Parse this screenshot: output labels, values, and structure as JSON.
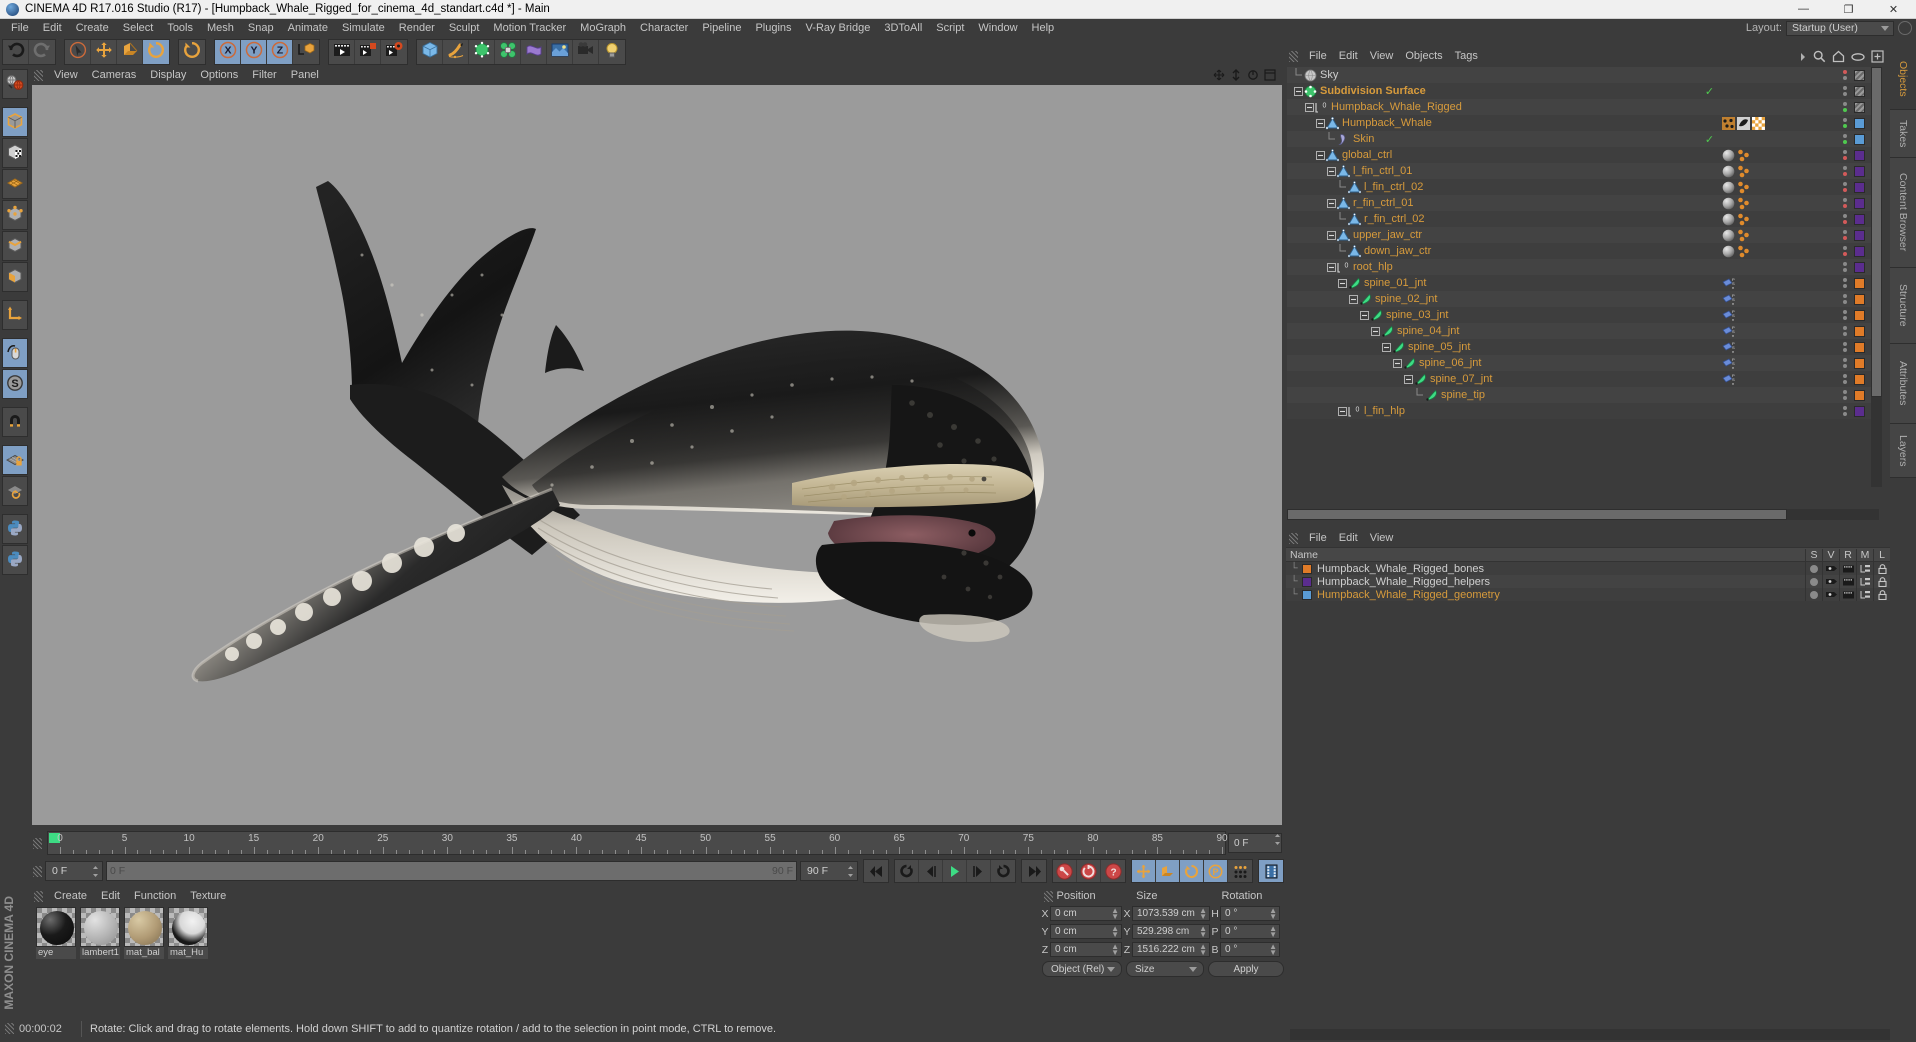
{
  "window": {
    "title": "CINEMA 4D R17.016 Studio (R17) - [Humpback_Whale_Rigged_for_cinema_4d_standart.c4d *] - Main",
    "minimize": "—",
    "maximize": "❐",
    "close": "✕"
  },
  "menubar": {
    "items": [
      "File",
      "Edit",
      "Create",
      "Select",
      "Tools",
      "Mesh",
      "Snap",
      "Animate",
      "Simulate",
      "Render",
      "Sculpt",
      "Motion Tracker",
      "MoGraph",
      "Character",
      "Pipeline",
      "Plugins",
      "V-Ray Bridge",
      "3DToAll",
      "Script",
      "Window",
      "Help"
    ],
    "layout_label": "Layout:",
    "layout_value": "Startup (User)"
  },
  "toolbar": {
    "groups": [
      {
        "name": "undo-redo",
        "buttons": [
          {
            "name": "undo-button",
            "icon": "undo-icon",
            "active": false
          },
          {
            "name": "redo-button",
            "icon": "redo-icon",
            "active": false
          }
        ]
      },
      {
        "name": "transform-tools",
        "buttons": [
          {
            "name": "select-tool",
            "icon": "select-cursor-icon",
            "active": false
          },
          {
            "name": "move-tool",
            "icon": "move-arrows-icon",
            "active": false
          },
          {
            "name": "scale-tool",
            "icon": "scale-box-icon",
            "active": false
          },
          {
            "name": "rotate-tool",
            "icon": "rotate-circle-icon",
            "active": true
          }
        ]
      },
      {
        "name": "rotate-group",
        "buttons": [
          {
            "name": "rotate-tool-2",
            "icon": "rotate-circle-icon",
            "active": false
          }
        ]
      },
      {
        "name": "axis-locks",
        "buttons": [
          {
            "name": "x-axis-lock",
            "icon": "x-axis-icon",
            "active": true
          },
          {
            "name": "y-axis-lock",
            "icon": "y-axis-icon",
            "active": true
          },
          {
            "name": "z-axis-lock",
            "icon": "z-axis-icon",
            "active": true
          },
          {
            "name": "world-object-axis",
            "icon": "world-axis-icon",
            "active": false
          }
        ]
      },
      {
        "name": "render-group",
        "buttons": [
          {
            "name": "render-view-button",
            "icon": "render-view-icon",
            "active": false
          },
          {
            "name": "render-to-picture-viewer-button",
            "icon": "render-picture-icon",
            "active": false
          },
          {
            "name": "render-settings-button",
            "icon": "render-settings-icon",
            "active": false
          }
        ]
      },
      {
        "name": "object-group",
        "buttons": [
          {
            "name": "add-cube-button",
            "icon": "cube-icon",
            "active": false
          },
          {
            "name": "add-spline-button",
            "icon": "pen-spline-icon",
            "active": false
          },
          {
            "name": "nurbs-button",
            "icon": "green-cube-icon",
            "active": false
          },
          {
            "name": "array-button",
            "icon": "green-cluster-icon",
            "active": false
          },
          {
            "name": "deformer-button",
            "icon": "deformer-icon",
            "active": false
          },
          {
            "name": "environment-button",
            "icon": "environment-icon",
            "active": false
          },
          {
            "name": "camera-button",
            "icon": "camera-icon",
            "active": false
          },
          {
            "name": "light-button",
            "icon": "light-bulb-icon",
            "active": false
          }
        ]
      }
    ]
  },
  "leftbar": {
    "buttons": [
      {
        "name": "make-editable-button",
        "icon": "world-globe-icon",
        "active": false
      },
      {
        "name": "model-mode-button",
        "icon": "model-cube-icon",
        "active": true
      },
      {
        "name": "texture-mode-button",
        "icon": "texture-cube-icon",
        "active": false
      },
      {
        "name": "polygon-mode-button",
        "icon": "polygon-grid-icon",
        "active": false
      },
      {
        "name": "point-mode-button",
        "icon": "point-cube-icon",
        "active": false
      },
      {
        "name": "edge-mode-button",
        "icon": "edge-cube-icon",
        "active": false
      },
      {
        "name": "face-mode-button",
        "icon": "face-cube-icon",
        "active": false
      },
      {
        "name": "axis-mode-button",
        "icon": "axis-l-icon",
        "active": false
      },
      {
        "name": "viewport-solo-button",
        "icon": "mouse-icon",
        "active": true
      },
      {
        "name": "soft-selection-button",
        "icon": "s-circle-icon",
        "active": true
      },
      {
        "name": "magnet-button",
        "icon": "magnet-icon",
        "active": false
      },
      {
        "name": "lock-workplane-button",
        "icon": "workplane-lock-icon",
        "active": true
      },
      {
        "name": "planar-workplane-button",
        "icon": "workplane-rotate-icon",
        "active": false
      },
      {
        "name": "python-button-1",
        "icon": "python-icon",
        "active": false
      },
      {
        "name": "python-button-2",
        "icon": "python-icon",
        "active": false
      }
    ],
    "brand": "MAXON CINEMA 4D"
  },
  "viewport": {
    "menu": [
      "View",
      "Cameras",
      "Display",
      "Options",
      "Filter",
      "Panel"
    ],
    "nav_icons": [
      "pan-icon",
      "zoom-icon",
      "rotate-icon",
      "maximize-icon"
    ],
    "background_color": "#9b9b9b",
    "subject": "humpback whale 3d model"
  },
  "timeline": {
    "start_label": "0",
    "ticks": [
      "0",
      "5",
      "10",
      "15",
      "20",
      "25",
      "30",
      "35",
      "40",
      "45",
      "50",
      "55",
      "60",
      "65",
      "70",
      "75",
      "80",
      "85",
      "90"
    ],
    "current_frame_field": "0 F",
    "left_frame_field": "0 F",
    "range_start": "0 F",
    "range_end": "90 F",
    "end_frame_field": "90 F",
    "transport_buttons": [
      {
        "name": "go-to-start-button",
        "icon": "skip-start-icon"
      },
      {
        "name": "play-backwards-button",
        "icon": "rewind-loop-icon"
      },
      {
        "name": "previous-frame-button",
        "icon": "step-back-icon"
      },
      {
        "name": "play-forward-button",
        "icon": "play-icon"
      },
      {
        "name": "next-frame-button",
        "icon": "step-forward-icon"
      },
      {
        "name": "play-loop-button",
        "icon": "loop-icon"
      },
      {
        "name": "go-to-end-button",
        "icon": "skip-end-icon"
      }
    ],
    "key_buttons": [
      {
        "name": "record-keyframe-button",
        "icon": "key-record-icon"
      },
      {
        "name": "autokeying-button",
        "icon": "autokey-icon"
      },
      {
        "name": "keyframe-selection-button",
        "icon": "key-question-icon"
      }
    ],
    "pos_buttons": [
      {
        "name": "record-position-button",
        "icon": "move-arrows-icon",
        "active": true
      },
      {
        "name": "record-scale-button",
        "icon": "scale-box-icon",
        "active": true
      },
      {
        "name": "record-rotation-button",
        "icon": "rotate-circle-icon",
        "active": true
      },
      {
        "name": "record-param-button",
        "icon": "p-circle-icon",
        "active": true
      },
      {
        "name": "record-pla-button",
        "icon": "dots-grid-icon",
        "active": false
      },
      {
        "name": "timeline-toggle-button",
        "icon": "film-strip-icon",
        "active": true
      }
    ]
  },
  "materials": {
    "menu": [
      "Create",
      "Edit",
      "Function",
      "Texture"
    ],
    "items": [
      {
        "name": "eye",
        "color": "#1a1a1a",
        "label": "eye"
      },
      {
        "name": "lambert1",
        "color": "#b4b4b4",
        "label": "lambert1"
      },
      {
        "name": "mat_ball",
        "color": "#b09a74",
        "label": "mat_bal"
      },
      {
        "name": "mat_Humpback",
        "color": "#e8e8e8",
        "label": "mat_Hu"
      }
    ]
  },
  "coordinates": {
    "headers": [
      "Position",
      "Size",
      "Rotation"
    ],
    "rows": [
      {
        "pos_axis": "X",
        "pos_value": "0 cm",
        "size_axis": "X",
        "size_value": "1073.539 cm",
        "rot_axis": "H",
        "rot_value": "0 °"
      },
      {
        "pos_axis": "Y",
        "pos_value": "0 cm",
        "size_axis": "Y",
        "size_value": "529.298 cm",
        "rot_axis": "P",
        "rot_value": "0 °"
      },
      {
        "pos_axis": "Z",
        "pos_value": "0 cm",
        "size_axis": "Z",
        "size_value": "1516.222 cm",
        "rot_axis": "B",
        "rot_value": "0 °"
      }
    ],
    "mode_dropdown": "Object (Rel)",
    "size_dropdown": "Size",
    "apply_button": "Apply"
  },
  "object_manager": {
    "menu": [
      "File",
      "Edit",
      "View",
      "Objects",
      "Tags"
    ],
    "right_icons": [
      "more-arrow-icon",
      "search-icon",
      "home-icon",
      "ellipse-icon",
      "add-icon"
    ],
    "tree": [
      {
        "label": "Sky",
        "indent": 0,
        "icon": "sky-sphere-icon",
        "color": "#cfcfcf",
        "expander": "none",
        "swatch": "hatch",
        "dots": [
          "#d35a5a",
          "#8a8a8a"
        ],
        "tags": [],
        "check": false
      },
      {
        "label": "Subdivision Surface",
        "indent": 0,
        "icon": "subdiv-icon",
        "color": "#d79b3c",
        "expander": "minus",
        "swatch": "hatch",
        "dots": [
          "#8a8a8a",
          "#8a8a8a"
        ],
        "tags": [],
        "check": true
      },
      {
        "label": "Humpback_Whale_Rigged",
        "indent": 1,
        "icon": "layer0-icon",
        "color": "#d79b3c",
        "expander": "minus",
        "swatch": "hatch",
        "dots": [
          "#8a8a8a",
          "#4fc94f"
        ],
        "tags": [],
        "check": false
      },
      {
        "label": "Humpback_Whale",
        "indent": 2,
        "icon": "polygon-obj-icon",
        "color": "#d79b3c",
        "expander": "minus",
        "swatch": "#5a9bd5",
        "dots": [
          "#8a8a8a",
          "#4fc94f"
        ],
        "tags": [
          "texture-tag",
          "phong-tag",
          "checker-tag"
        ],
        "check": false
      },
      {
        "label": "Skin",
        "indent": 3,
        "icon": "skin-icon",
        "color": "#d79b3c",
        "expander": "end",
        "swatch": "#5a9bd5",
        "dots": [
          "#8a8a8a",
          "#4fc94f"
        ],
        "tags": [],
        "check": true
      },
      {
        "label": "global_ctrl",
        "indent": 2,
        "icon": "null-obj-icon",
        "color": "#d79b3c",
        "expander": "minus",
        "swatch": "#5b2d8e",
        "dots": [
          "#8a8a8a",
          "#d35a5a"
        ],
        "tags": [
          "sphere-tag",
          "xpresso-tag"
        ],
        "check": false
      },
      {
        "label": "l_fin_ctrl_01",
        "indent": 3,
        "icon": "null-obj-icon",
        "color": "#d79b3c",
        "expander": "minus",
        "swatch": "#5b2d8e",
        "dots": [
          "#8a8a8a",
          "#d35a5a"
        ],
        "tags": [
          "sphere-tag",
          "xpresso-tag"
        ],
        "check": false
      },
      {
        "label": "l_fin_ctrl_02",
        "indent": 4,
        "icon": "null-obj-icon",
        "color": "#d79b3c",
        "expander": "end",
        "swatch": "#5b2d8e",
        "dots": [
          "#8a8a8a",
          "#d35a5a"
        ],
        "tags": [
          "sphere-tag",
          "xpresso-tag"
        ],
        "check": false
      },
      {
        "label": "r_fin_ctrl_01",
        "indent": 3,
        "icon": "null-obj-icon",
        "color": "#d79b3c",
        "expander": "minus",
        "swatch": "#5b2d8e",
        "dots": [
          "#8a8a8a",
          "#d35a5a"
        ],
        "tags": [
          "sphere-tag",
          "xpresso-tag"
        ],
        "check": false
      },
      {
        "label": "r_fin_ctrl_02",
        "indent": 4,
        "icon": "null-obj-icon",
        "color": "#d79b3c",
        "expander": "end",
        "swatch": "#5b2d8e",
        "dots": [
          "#8a8a8a",
          "#d35a5a"
        ],
        "tags": [
          "sphere-tag",
          "xpresso-tag"
        ],
        "check": false
      },
      {
        "label": "upper_jaw_ctr",
        "indent": 3,
        "icon": "null-obj-icon",
        "color": "#d79b3c",
        "expander": "minus",
        "swatch": "#5b2d8e",
        "dots": [
          "#8a8a8a",
          "#d35a5a"
        ],
        "tags": [
          "sphere-tag",
          "xpresso-tag"
        ],
        "check": false
      },
      {
        "label": "down_jaw_ctr",
        "indent": 4,
        "icon": "null-obj-icon",
        "color": "#d79b3c",
        "expander": "end",
        "swatch": "#5b2d8e",
        "dots": [
          "#8a8a8a",
          "#d35a5a"
        ],
        "tags": [
          "sphere-tag",
          "xpresso-tag"
        ],
        "check": false
      },
      {
        "label": "root_hlp",
        "indent": 3,
        "icon": "layer0-icon",
        "color": "#d79b3c",
        "expander": "minus",
        "swatch": "#5b2d8e",
        "dots": [
          "#8a8a8a",
          "#8a8a8a"
        ],
        "tags": [],
        "check": false
      },
      {
        "label": "spine_01_jnt",
        "indent": 4,
        "icon": "joint-icon",
        "color": "#d79b3c",
        "expander": "minus",
        "swatch": "#e07b28",
        "dots": [
          "#8a8a8a",
          "#8a8a8a"
        ],
        "tags": [
          "weight-tag"
        ],
        "check": false
      },
      {
        "label": "spine_02_jnt",
        "indent": 5,
        "icon": "joint-icon",
        "color": "#d79b3c",
        "expander": "minus",
        "swatch": "#e07b28",
        "dots": [
          "#8a8a8a",
          "#8a8a8a"
        ],
        "tags": [
          "weight-tag"
        ],
        "check": false
      },
      {
        "label": "spine_03_jnt",
        "indent": 6,
        "icon": "joint-icon",
        "color": "#d79b3c",
        "expander": "minus",
        "swatch": "#e07b28",
        "dots": [
          "#8a8a8a",
          "#8a8a8a"
        ],
        "tags": [
          "weight-tag"
        ],
        "check": false
      },
      {
        "label": "spine_04_jnt",
        "indent": 7,
        "icon": "joint-icon",
        "color": "#d79b3c",
        "expander": "minus",
        "swatch": "#e07b28",
        "dots": [
          "#8a8a8a",
          "#8a8a8a"
        ],
        "tags": [
          "weight-tag"
        ],
        "check": false
      },
      {
        "label": "spine_05_jnt",
        "indent": 8,
        "icon": "joint-icon",
        "color": "#d79b3c",
        "expander": "minus",
        "swatch": "#e07b28",
        "dots": [
          "#8a8a8a",
          "#8a8a8a"
        ],
        "tags": [
          "weight-tag"
        ],
        "check": false
      },
      {
        "label": "spine_06_jnt",
        "indent": 9,
        "icon": "joint-icon",
        "color": "#d79b3c",
        "expander": "minus",
        "swatch": "#e07b28",
        "dots": [
          "#8a8a8a",
          "#8a8a8a"
        ],
        "tags": [
          "weight-tag"
        ],
        "check": false
      },
      {
        "label": "spine_07_jnt",
        "indent": 10,
        "icon": "joint-icon",
        "color": "#d79b3c",
        "expander": "minus",
        "swatch": "#e07b28",
        "dots": [
          "#8a8a8a",
          "#8a8a8a"
        ],
        "tags": [
          "weight-tag"
        ],
        "check": false
      },
      {
        "label": "spine_tip",
        "indent": 11,
        "icon": "joint-icon",
        "color": "#d79b3c",
        "expander": "end",
        "swatch": "#e07b28",
        "dots": [
          "#8a8a8a",
          "#8a8a8a"
        ],
        "tags": [],
        "check": false
      },
      {
        "label": "l_fin_hlp",
        "indent": 4,
        "icon": "layer0-icon",
        "color": "#d79b3c",
        "expander": "minus",
        "swatch": "#5b2d8e",
        "dots": [
          "#8a8a8a",
          "#8a8a8a"
        ],
        "tags": [],
        "check": false
      }
    ]
  },
  "layer_manager": {
    "menu": [
      "File",
      "Edit",
      "View"
    ],
    "columns": [
      "Name",
      "S",
      "V",
      "R",
      "M",
      "L"
    ],
    "rows": [
      {
        "name": "Humpback_Whale_Rigged_bones",
        "color": "#e07b28",
        "selected": false
      },
      {
        "name": "Humpback_Whale_Rigged_helpers",
        "color": "#5b2d8e",
        "selected": false
      },
      {
        "name": "Humpback_Whale_Rigged_geometry",
        "color": "#5a9bd5",
        "selected": true
      }
    ]
  },
  "right_tabs": [
    {
      "label": "Objects",
      "active": true
    },
    {
      "label": "Takes",
      "active": false
    },
    {
      "label": "Content Browser",
      "active": false
    },
    {
      "label": "Structure",
      "active": false
    },
    {
      "label": "Attributes",
      "active": false
    },
    {
      "label": "Layers",
      "active": false
    }
  ],
  "statusbar": {
    "time": "00:00:02",
    "message": "Rotate: Click and drag to rotate elements. Hold down SHIFT to add to quantize rotation / add to the selection in point mode, CTRL to remove."
  }
}
